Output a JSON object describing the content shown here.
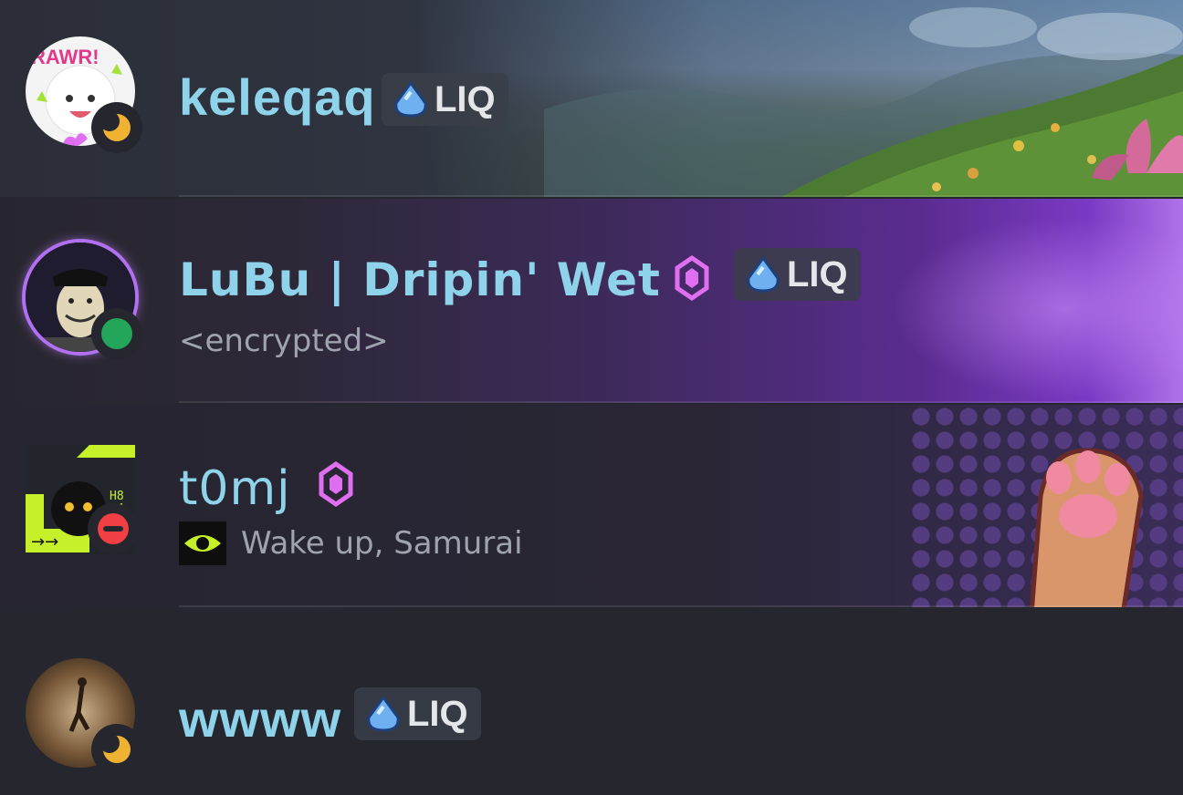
{
  "members": [
    {
      "name": "keleqaq",
      "status": "idle",
      "tag": {
        "icon": "droplet-icon",
        "label": "LIQ"
      },
      "subtitle": "",
      "booster": false,
      "avatar_text": "RAWR!"
    },
    {
      "name": "LuBu | Dripin' Wet",
      "status": "online",
      "tag": {
        "icon": "droplet-icon",
        "label": "LIQ"
      },
      "subtitle": "<encrypted>",
      "booster": true
    },
    {
      "name": "t0mj",
      "status": "dnd",
      "tag": null,
      "subtitle": "Wake up, Samurai",
      "subtitle_icon": "eye-icon",
      "booster": true,
      "avatar_text": "H8 S4"
    },
    {
      "name": "wwww",
      "status": "idle",
      "tag": {
        "icon": "droplet-icon",
        "label": "LIQ"
      },
      "subtitle": "",
      "booster": false
    }
  ],
  "colors": {
    "name": "#8fd3ea",
    "online": "#23a55a",
    "idle": "#f0b232",
    "dnd": "#f23f43",
    "booster": "#e06ef0"
  }
}
